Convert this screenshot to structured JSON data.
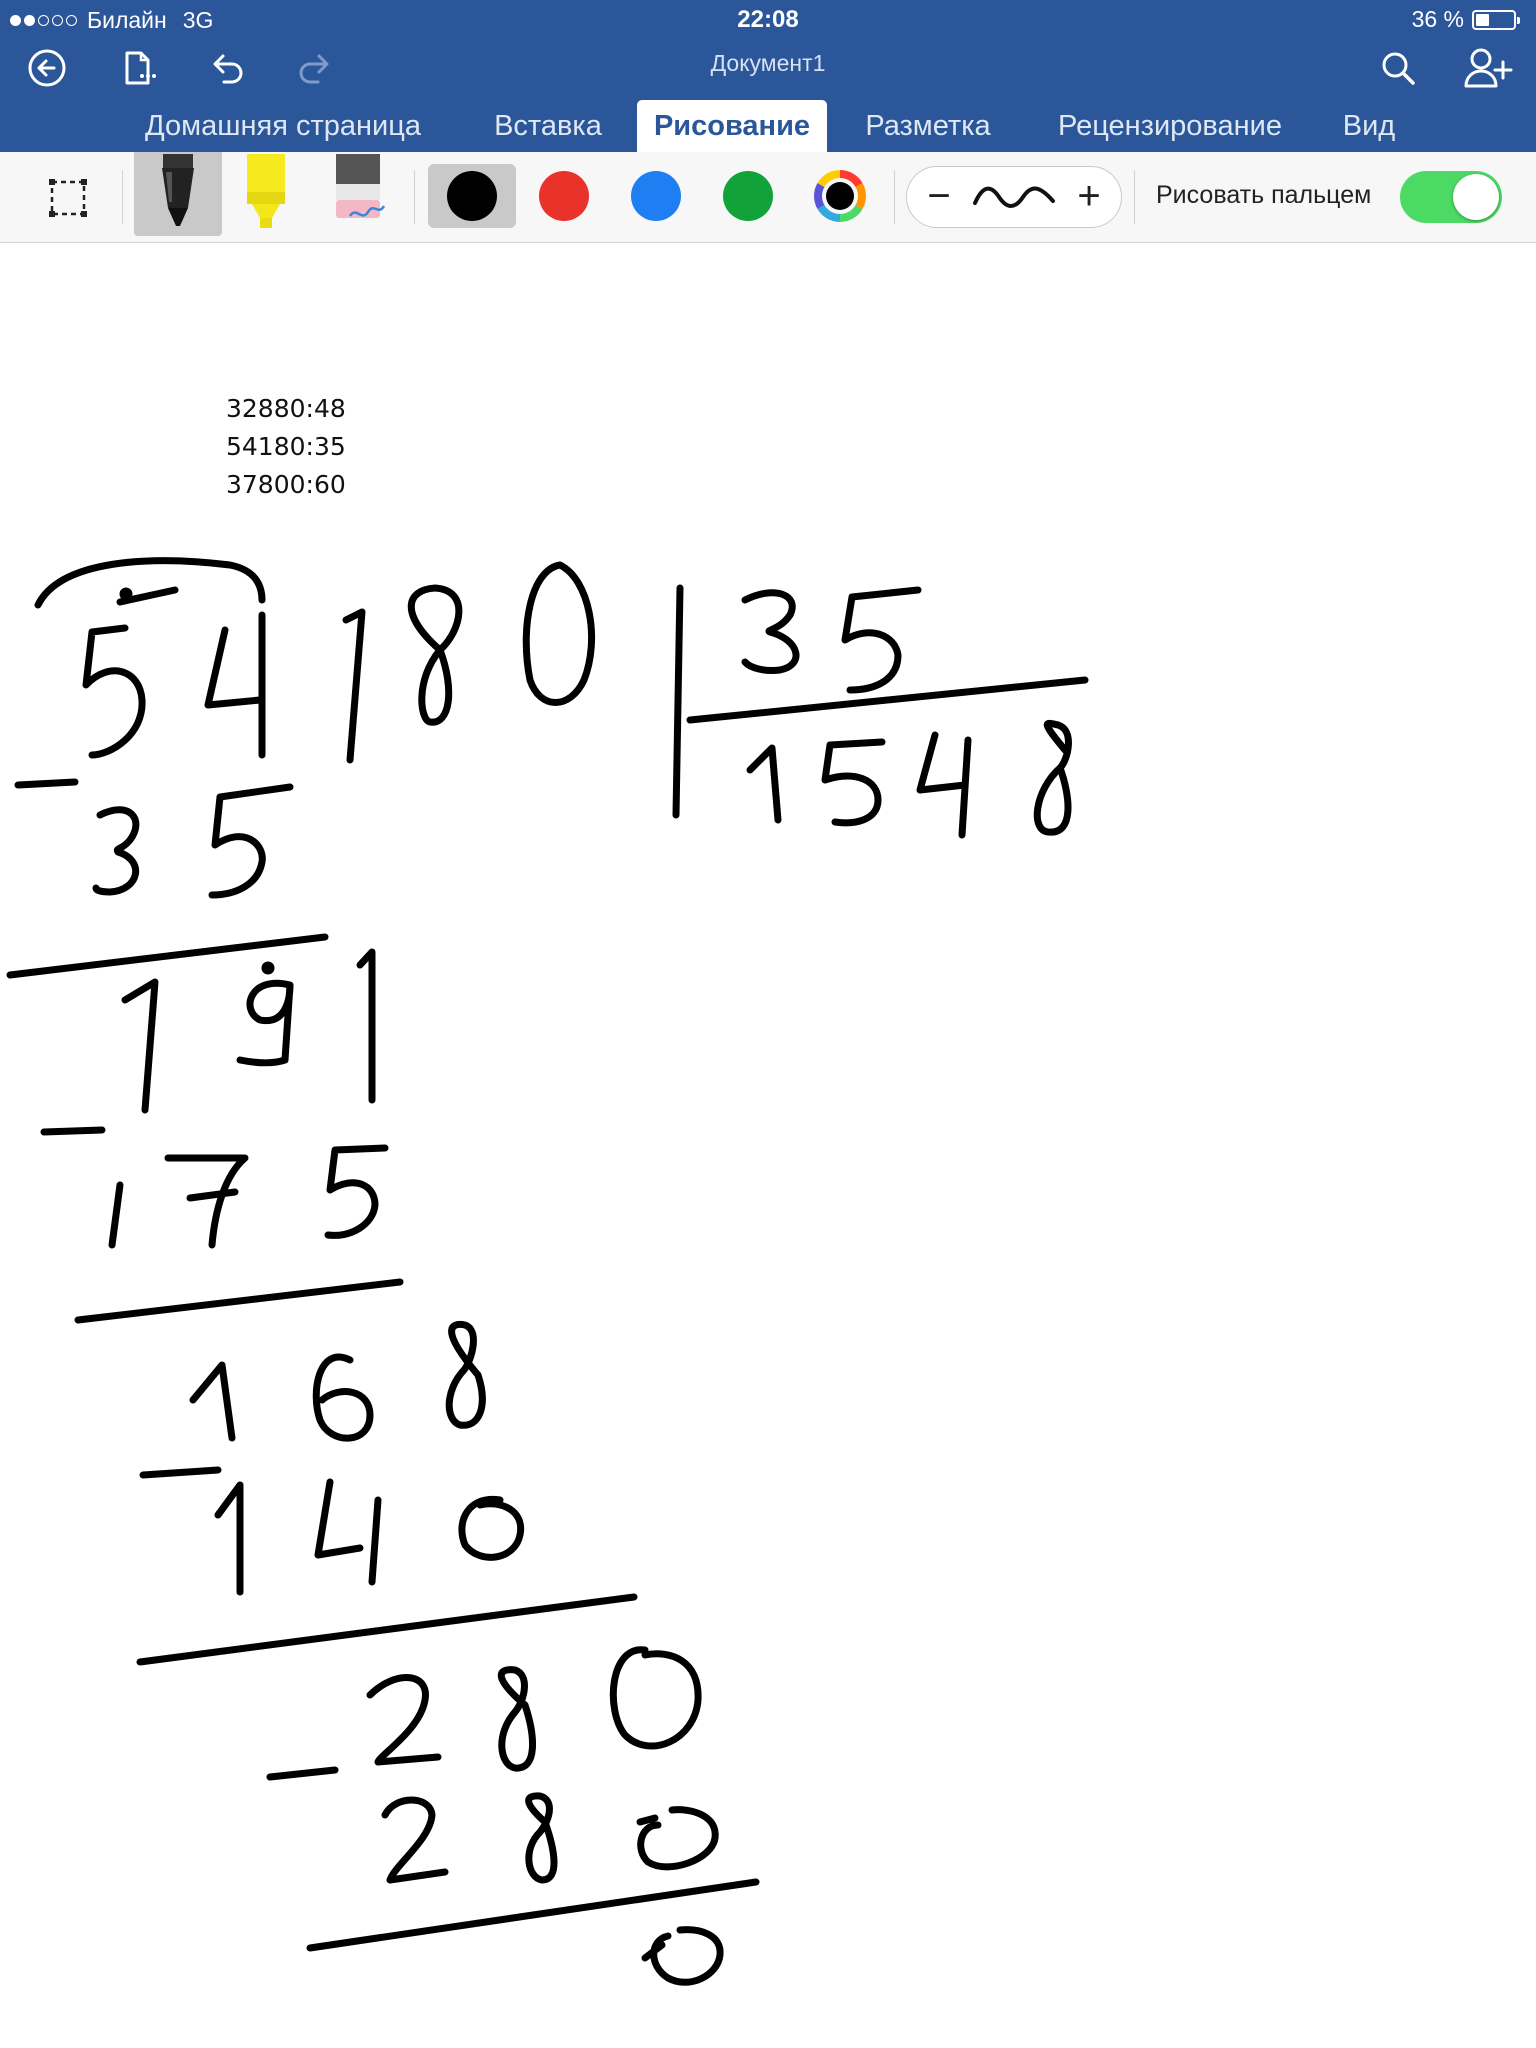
{
  "status_bar": {
    "carrier": "Билайн",
    "network": "3G",
    "time": "22:08",
    "battery_text": "36 %",
    "battery_level": 0.36,
    "signal_dots_filled": 2,
    "signal_dots_total": 5
  },
  "app_bar": {
    "document_title": "Документ1"
  },
  "tabs": [
    {
      "label": "Домашняя страница",
      "active": false
    },
    {
      "label": "Вставка",
      "active": false
    },
    {
      "label": "Рисование",
      "active": true
    },
    {
      "label": "Разметка",
      "active": false
    },
    {
      "label": "Рецензирование",
      "active": false
    },
    {
      "label": "Вид",
      "active": false
    }
  ],
  "ribbon": {
    "pen_colors": [
      "#000000",
      "#e8322a",
      "#1f7ef2",
      "#11a339"
    ],
    "selected_color": "#000000",
    "finger_draw_label": "Рисовать пальцем",
    "finger_draw_on": true
  },
  "document": {
    "typed_lines": [
      "32880:48",
      "54180:35",
      "37800:60"
    ],
    "handwritten": {
      "dividend": "54180",
      "divisor": "35",
      "quotient": "1548",
      "steps": [
        "35",
        "191",
        "175",
        "168",
        "140",
        "280",
        "280",
        "0"
      ]
    }
  },
  "colors": {
    "accent": "#2b579a",
    "toggle_on": "#4cd964"
  }
}
